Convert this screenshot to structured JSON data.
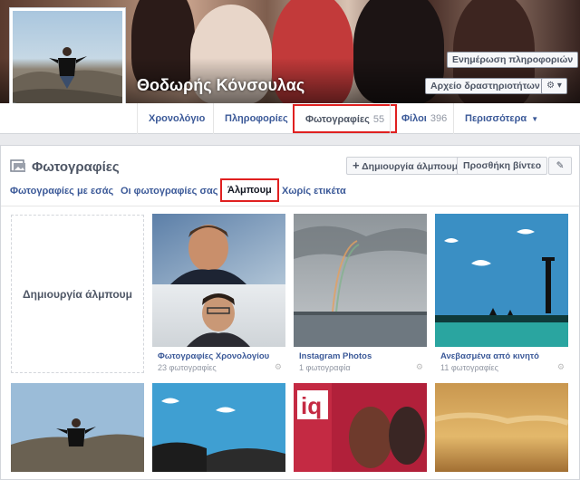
{
  "profile": {
    "name": "Θοδωρής Κόνσουλας",
    "update_info_label": "Ενημέρωση πληροφοριών",
    "activity_log_label": "Αρχείο δραστηριοτήτων",
    "settings_icon": "gear-icon",
    "camera_icon": "camera-icon"
  },
  "nav": {
    "items": [
      {
        "label": "Χρονολόγιο",
        "count": ""
      },
      {
        "label": "Πληροφορίες",
        "count": ""
      },
      {
        "label": "Φωτογραφίες",
        "count": "55"
      },
      {
        "label": "Φίλοι",
        "count": "396"
      },
      {
        "label": "Περισσότερα",
        "count": ""
      }
    ],
    "active": "Φωτογραφίες"
  },
  "photos": {
    "title": "Φωτογραφίες",
    "create_album_label": "Δημιουργία άλμπουμ",
    "add_video_label": "Προσθήκη βίντεο",
    "tabs": [
      {
        "label": "Φωτογραφίες με εσάς"
      },
      {
        "label": "Οι φωτογραφίες σας"
      },
      {
        "label": "Άλμπουμ"
      },
      {
        "label": "Χωρίς ετικέτα"
      }
    ],
    "active_tab": "Άλμπουμ",
    "create_album_tile": "Δημιουργία άλμπουμ",
    "albums": [
      {
        "title": "Φωτογραφίες Χρονολογίου",
        "count": "23 φωτογραφίες"
      },
      {
        "title": "Instagram Photos",
        "count": "1 φωτογραφία"
      },
      {
        "title": "Ανεβασμένα από κινητό",
        "count": "11 φωτογραφίες"
      }
    ]
  },
  "colors": {
    "link": "#3b5998",
    "highlight": "#e02020",
    "page_bg": "#e9eaed"
  }
}
